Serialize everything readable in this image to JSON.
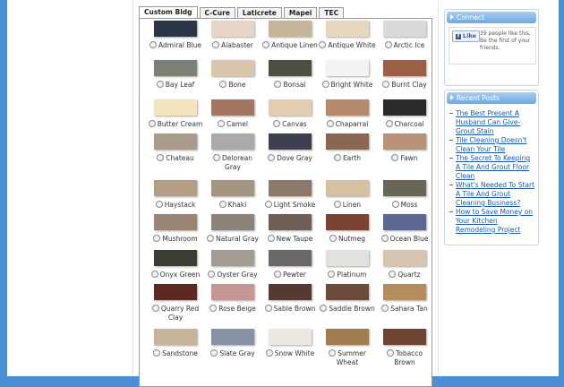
{
  "tabs": [
    "Custom Bldg",
    "C-Cure",
    "Laticrete",
    "Mapei",
    "TEC"
  ],
  "active_tab": "Custom Bldg",
  "colors": [
    {
      "name": "Admiral Blue",
      "hex": "#2a3547"
    },
    {
      "name": "Alabaster",
      "hex": "#e7d6c8"
    },
    {
      "name": "Antique Linen",
      "hex": "#c7b59a"
    },
    {
      "name": "Antique White",
      "hex": "#e6d8be"
    },
    {
      "name": "Arctic Ice",
      "hex": "#d9dadb"
    },
    {
      "name": "Bay Leaf",
      "hex": "#7c8178"
    },
    {
      "name": "Bone",
      "hex": "#d9c6ae"
    },
    {
      "name": "Bonsai",
      "hex": "#4b5041"
    },
    {
      "name": "Bright White",
      "hex": "#f3f3f1"
    },
    {
      "name": "Burnt Clay",
      "hex": "#9c5f46"
    },
    {
      "name": "Butter Cream",
      "hex": "#f4e4bd"
    },
    {
      "name": "Camel",
      "hex": "#a3765f"
    },
    {
      "name": "Canvas",
      "hex": "#e3cdb2"
    },
    {
      "name": "Chaparral",
      "hex": "#b58a6c"
    },
    {
      "name": "Charcoal",
      "hex": "#2b2b2d"
    },
    {
      "name": "Chateau",
      "hex": "#a99c8c"
    },
    {
      "name": "Delorean Gray",
      "hex": "#a9aaab"
    },
    {
      "name": "Dove Gray",
      "hex": "#3d3f4e"
    },
    {
      "name": "Earth",
      "hex": "#8a6752"
    },
    {
      "name": "Fawn",
      "hex": "#b69378"
    },
    {
      "name": "Haystack",
      "hex": "#b29f86"
    },
    {
      "name": "Khaki",
      "hex": "#a39581"
    },
    {
      "name": "Light Smoke",
      "hex": "#8b7a69"
    },
    {
      "name": "Linen",
      "hex": "#d5c0a2"
    },
    {
      "name": "Moss",
      "hex": "#6a6655"
    },
    {
      "name": "Mushroom",
      "hex": "#9a8474"
    },
    {
      "name": "Natural Gray",
      "hex": "#8b847a"
    },
    {
      "name": "New Taupe",
      "hex": "#6d5f55"
    },
    {
      "name": "Nutmeg",
      "hex": "#7a4332"
    },
    {
      "name": "Ocean Blue",
      "hex": "#5b6691"
    },
    {
      "name": "Onyx Green",
      "hex": "#3b3c35"
    },
    {
      "name": "Oyster Gray",
      "hex": "#a29d92"
    },
    {
      "name": "Pewter",
      "hex": "#6b6667"
    },
    {
      "name": "Platinum",
      "hex": "#e4e2de"
    },
    {
      "name": "Quartz",
      "hex": "#d7c4b1"
    },
    {
      "name": "Quarry Red Clay",
      "hex": "#5d2a22"
    },
    {
      "name": "Rose Beige",
      "hex": "#c49794"
    },
    {
      "name": "Sable Brown",
      "hex": "#553a34"
    },
    {
      "name": "Saddle Brown",
      "hex": "#6d4b3a"
    },
    {
      "name": "Sahara Tan",
      "hex": "#b38d5c"
    },
    {
      "name": "Sandstone",
      "hex": "#c8b49c"
    },
    {
      "name": "Slate Gray",
      "hex": "#8892a6"
    },
    {
      "name": "Snow White",
      "hex": "#ede8e2"
    },
    {
      "name": "Summer Wheat",
      "hex": "#a07c4e"
    },
    {
      "name": "Tobacco Brown",
      "hex": "#6d4532"
    }
  ],
  "sidebar": {
    "connect": {
      "title": "Connect",
      "like_label": "Like",
      "like_text": "39 people like this. Be the first of your friends."
    },
    "recent_posts": {
      "title": "Recent Posts",
      "items": [
        "The Best Present A Husband Can Give- Grout Stain",
        "Tile Cleaning Doesn't Clean Your Tile",
        "The Secret To Keeping A Tile And Grout Floor Clean",
        "What's Needed To Start A Tile And Grout Cleaning Business?",
        "How to Save Money on Your Kitchen Remodeling Project"
      ]
    }
  }
}
